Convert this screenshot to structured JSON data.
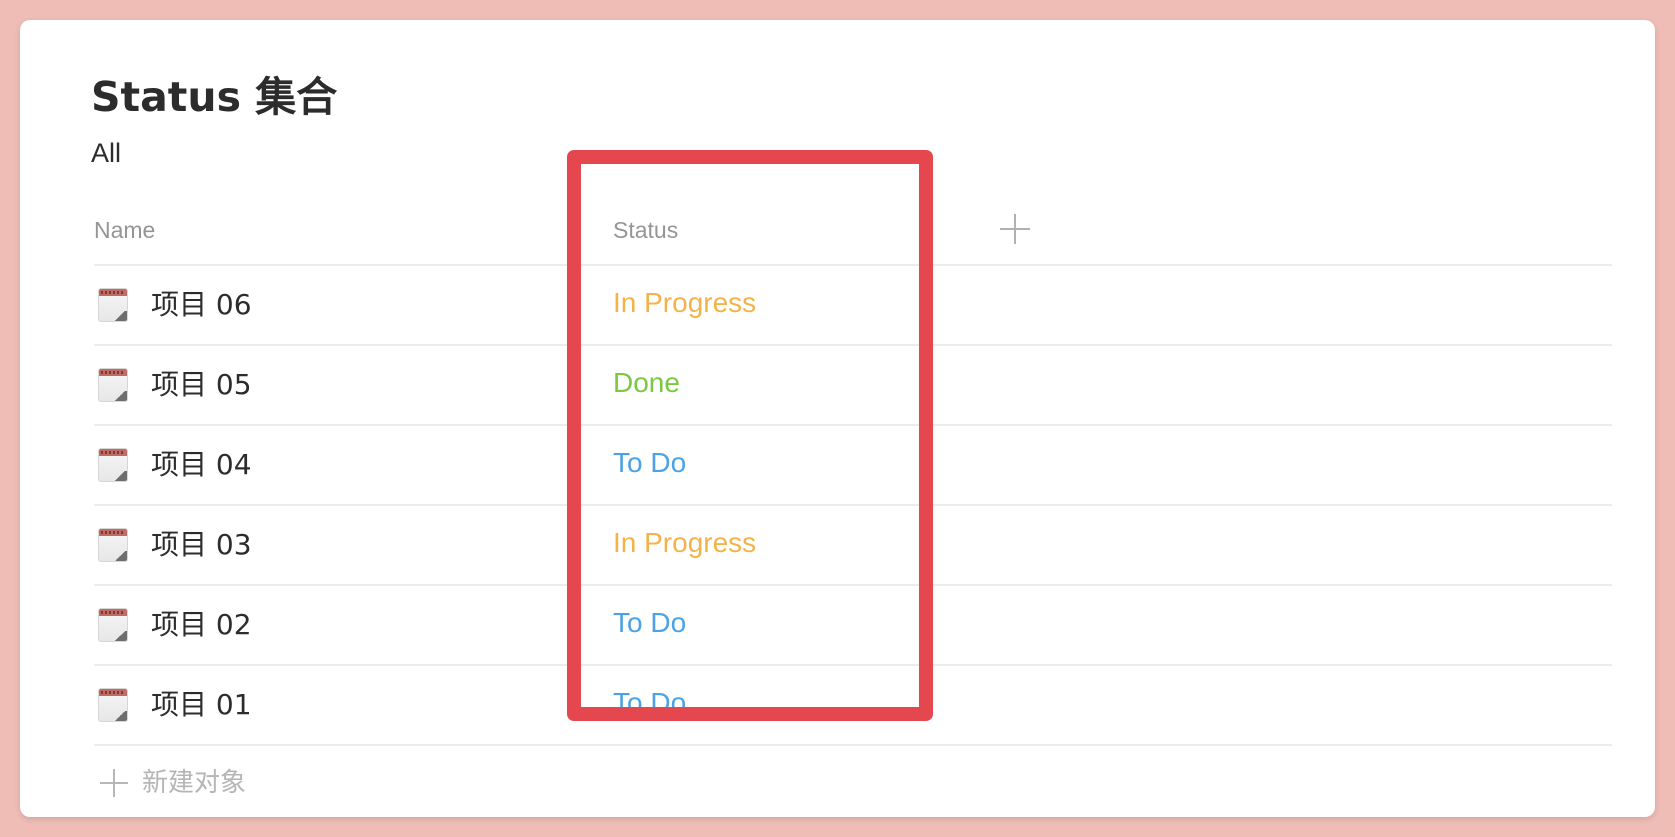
{
  "page": {
    "title": "Status 集合",
    "view_tab": "All"
  },
  "table": {
    "columns": [
      {
        "label": "Name"
      },
      {
        "label": "Status"
      }
    ],
    "rows": [
      {
        "name": "项目 06",
        "status": "In Progress",
        "status_color": "#f2b34a",
        "icon": "calendar-icon"
      },
      {
        "name": "项目 05",
        "status": "Done",
        "status_color": "#7ac943",
        "icon": "calendar-icon"
      },
      {
        "name": "项目 04",
        "status": "To Do",
        "status_color": "#4da1e5",
        "icon": "calendar-icon"
      },
      {
        "name": "项目 03",
        "status": "In Progress",
        "status_color": "#f2b34a",
        "icon": "calendar-icon"
      },
      {
        "name": "项目 02",
        "status": "To Do",
        "status_color": "#4da1e5",
        "icon": "calendar-icon"
      },
      {
        "name": "项目 01",
        "status": "To Do",
        "status_color": "#4da1e5",
        "icon": "calendar-icon"
      }
    ],
    "new_row_label": "新建对象"
  },
  "annotation": {
    "highlight_color": "#e5474e",
    "highlight_target": "status-column"
  },
  "colors": {
    "background": "#efbcb6",
    "card": "#ffffff",
    "in_progress": "#f2b34a",
    "done": "#7ac943",
    "todo": "#4da1e5"
  }
}
